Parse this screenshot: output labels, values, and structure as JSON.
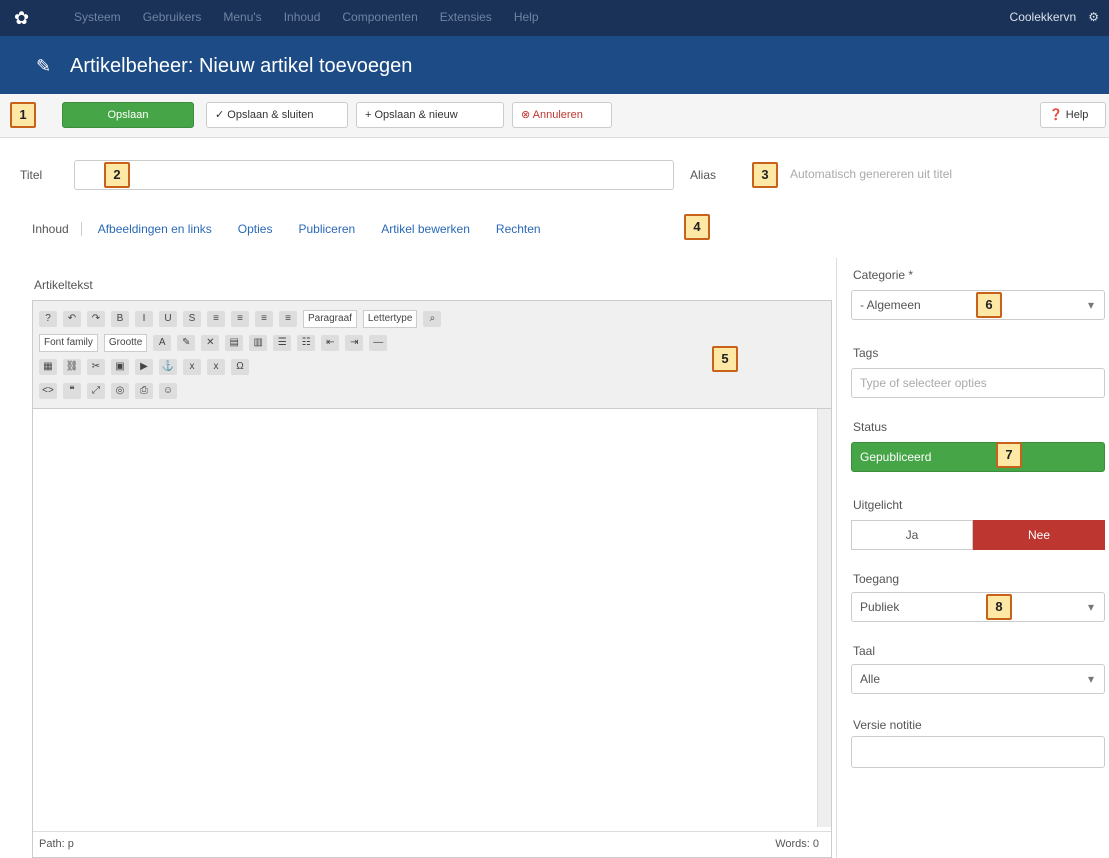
{
  "topnav": {
    "menu": [
      "Systeem",
      "Gebruikers",
      "Menu's",
      "Inhoud",
      "Componenten",
      "Extensies",
      "Help"
    ],
    "site_link": "Coolekkervn",
    "user_icon_label": "⚙"
  },
  "header": {
    "title": "Artikelbeheer: Nieuw artikel toevoegen"
  },
  "toolbar": {
    "save": "Opslaan",
    "save_close": "Opslaan & sluiten",
    "save_new": "Opslaan & nieuw",
    "cancel": "Annuleren",
    "help": "Help"
  },
  "form": {
    "title_label": "Titel",
    "title_value": "",
    "alias_label": "Alias",
    "alias_placeholder": "Automatisch genereren uit titel"
  },
  "tabs": [
    "Inhoud",
    "Afbeeldingen en links",
    "Opties",
    "Publiceren",
    "Artikel bewerken",
    "Rechten"
  ],
  "editor": {
    "label": "Artikeltekst",
    "format_select": "Paragraaf",
    "font_select": "Lettertype",
    "size_select": "Grootte",
    "font_family_select": "Font family",
    "status_path": "Path: p",
    "word_count": "Words: 0"
  },
  "sidebar": {
    "category_label": "Categorie *",
    "category_value": "- Algemeen",
    "tags_label": "Tags",
    "tags_placeholder": "Type of selecteer opties",
    "status_label": "Status",
    "status_value": "Gepubliceerd",
    "featured_label": "Uitgelicht",
    "featured_no": "Ja",
    "featured_yes": "Nee",
    "access_label": "Toegang",
    "access_value": "Publiek",
    "language_label": "Taal",
    "language_value": "Alle",
    "version_label": "Versie notitie",
    "version_value": ""
  },
  "callouts": [
    "1",
    "2",
    "3",
    "4",
    "5",
    "6",
    "7",
    "8"
  ]
}
